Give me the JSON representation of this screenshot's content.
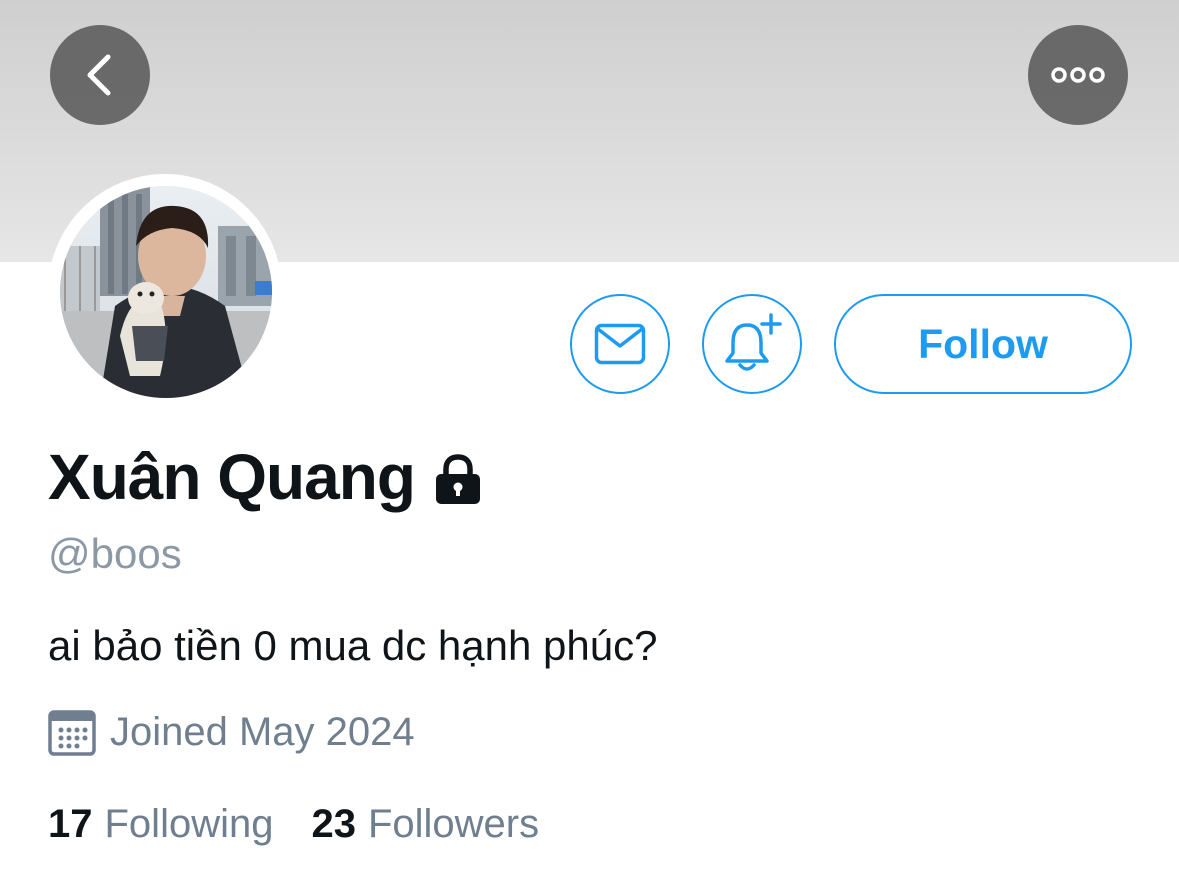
{
  "profile": {
    "display_name": "Xuân Quang",
    "handle": "@boos",
    "bio": "ai bảo tiền 0 mua dc hạnh phúc?",
    "joined": "Joined May 2024",
    "protected": true
  },
  "actions": {
    "follow_label": "Follow"
  },
  "stats": {
    "following_count": "17",
    "following_label": "Following",
    "followers_count": "23",
    "followers_label": "Followers"
  },
  "icons": {
    "back": "chevron-left-icon",
    "more": "more-horizontal-icon",
    "message": "envelope-icon",
    "notifications": "bell-plus-icon",
    "lock": "lock-icon",
    "calendar": "calendar-icon"
  },
  "colors": {
    "accent": "#1d9bf0",
    "text_primary": "#0f1419",
    "text_secondary": "#6f7f8f",
    "banner": "#d6d6d6"
  }
}
